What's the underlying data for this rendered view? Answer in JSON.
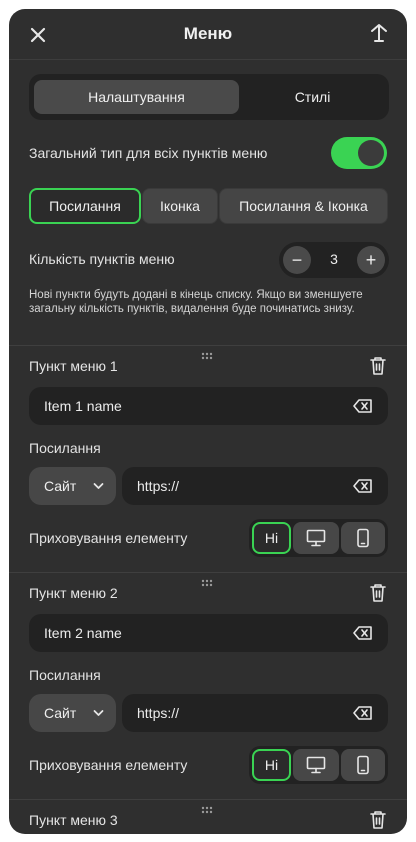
{
  "header": {
    "title": "Меню",
    "close_icon": "close-icon",
    "export_icon": "export-icon"
  },
  "tabs": [
    {
      "label": "Налаштування",
      "active": true
    },
    {
      "label": "Стилі",
      "active": false
    }
  ],
  "general_type": {
    "label": "Загальний тип для всіх пунктів меню",
    "enabled": true
  },
  "link_type": {
    "options": [
      {
        "label": "Посилання",
        "selected": true
      },
      {
        "label": "Іконка",
        "selected": false
      },
      {
        "label": "Посилання & Іконка",
        "selected": false
      }
    ]
  },
  "count": {
    "label": "Кількість пунктів меню",
    "value": "3",
    "minus": "−",
    "plus": "+"
  },
  "note": "Нові пункти будуть додані в кінець списку. Якщо ви зменшуете загальну кількість пунктів, видалення буде починатись знизу.",
  "items": [
    {
      "title": "Пункт меню 1",
      "name_value": "Item 1 name",
      "link_label": "Посилання",
      "link_type": "Сайт",
      "url_value": "https://",
      "hide_label": "Приховування елементу",
      "hide_none": "Ні"
    },
    {
      "title": "Пункт меню 2",
      "name_value": "Item 2 name",
      "link_label": "Посилання",
      "link_type": "Сайт",
      "url_value": "https://",
      "hide_label": "Приховування елементу",
      "hide_none": "Ні"
    },
    {
      "title": "Пункт меню 3"
    }
  ],
  "colors": {
    "accent": "#3ad353",
    "panel": "#2f2f2f",
    "field": "#222222"
  }
}
